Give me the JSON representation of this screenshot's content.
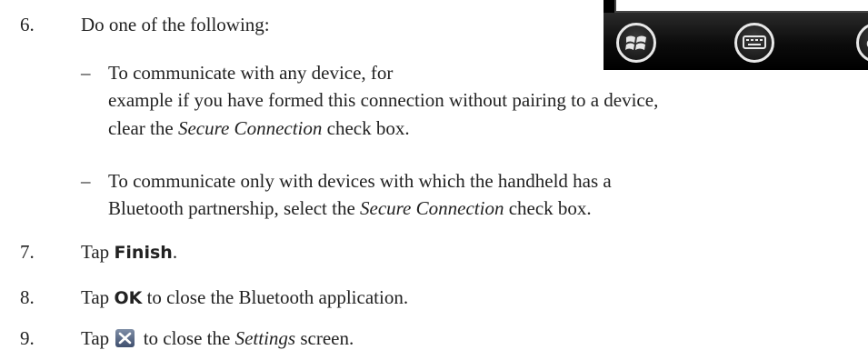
{
  "steps": [
    {
      "num": "6.",
      "text": "Do one of the following:"
    },
    {
      "num": "7.",
      "prefix": "Tap ",
      "bold": "Finish",
      "suffix": "."
    },
    {
      "num": "8.",
      "prefix": "Tap ",
      "bold": "OK",
      "suffix": " to close the Bluetooth application."
    },
    {
      "num": "9.",
      "prefix": "Tap ",
      "icon": "close-icon",
      "pre_italic": " to close the ",
      "italic": "Settings",
      "suffix": " screen."
    }
  ],
  "bullets": [
    {
      "dash": "–",
      "line1": "To communicate with any device, for",
      "line2": "example if you have formed this connection without pairing to a device,",
      "line3_italic": "Secure Connection",
      "line3_prefix": "clear the ",
      "line3_suffix": " check box."
    },
    {
      "dash": "–",
      "line1": "To communicate only with devices with which the handheld has a",
      "line2_prefix": "Bluetooth partnership, select the ",
      "line2_italic": "Secure Connection",
      "line2_suffix": " check box."
    }
  ],
  "device": {
    "buttons": [
      "windows-start-icon",
      "keyboard-icon",
      "ok-icon"
    ],
    "ok_label": "o"
  }
}
